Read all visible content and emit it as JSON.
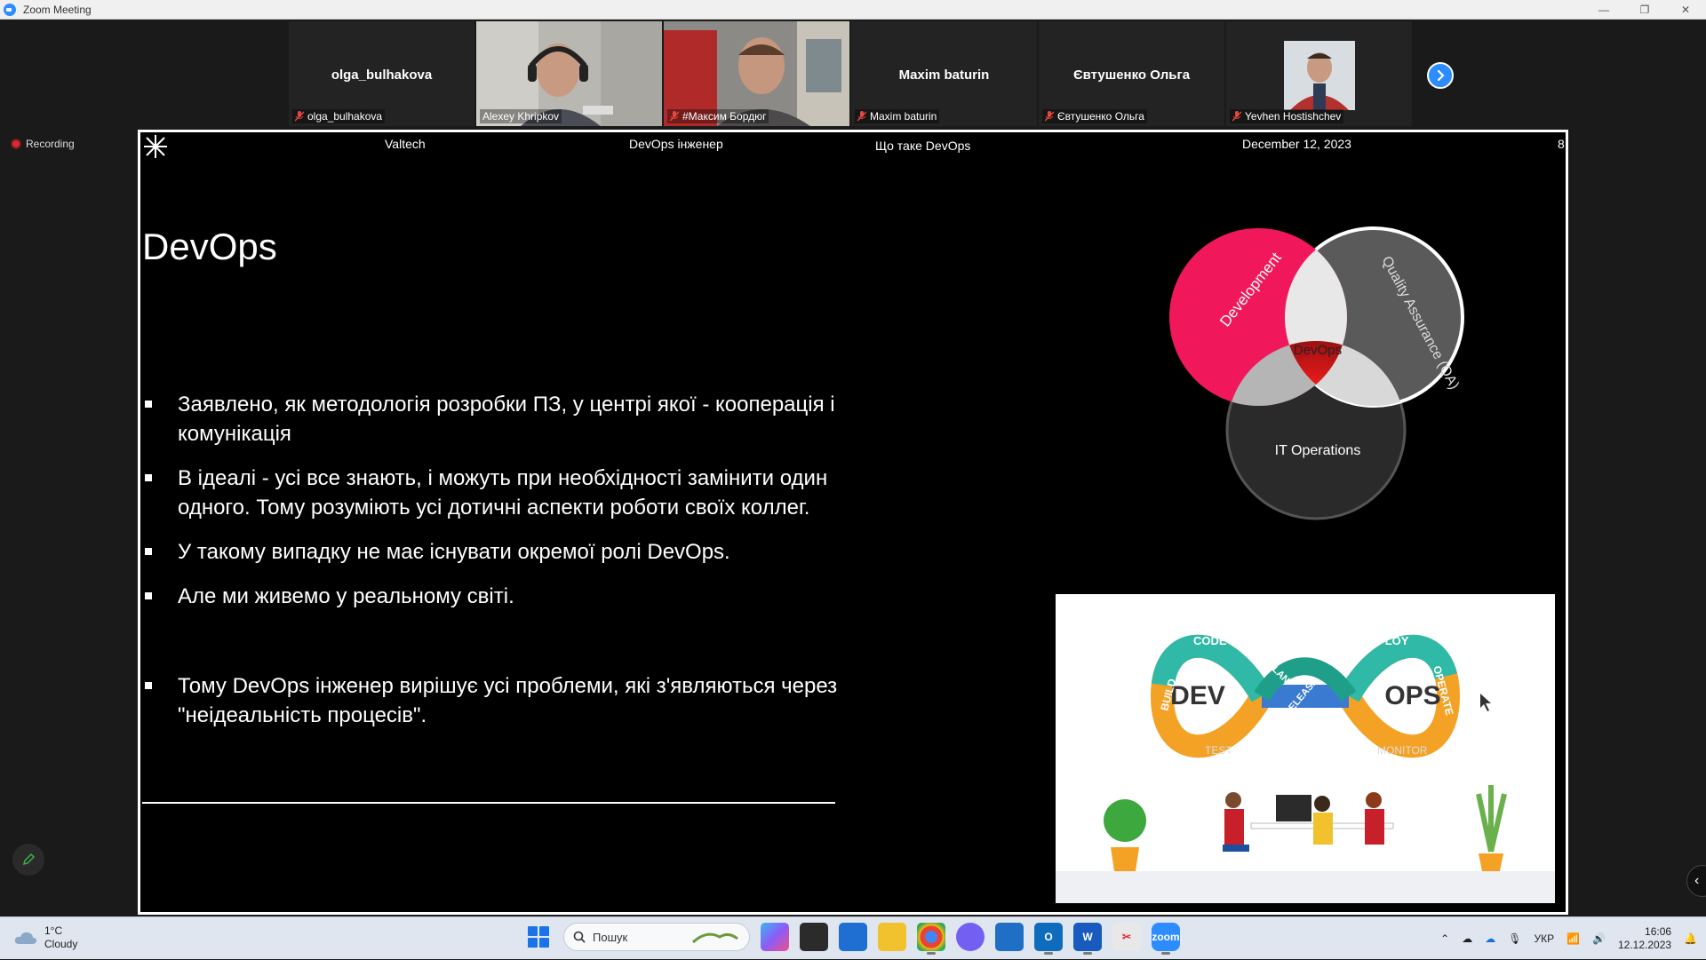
{
  "window": {
    "title": "Zoom Meeting",
    "controls": [
      "—",
      "❐",
      "✕"
    ]
  },
  "participants": [
    {
      "name": "olga_bulhakova",
      "caption": "olga_bulhakova",
      "video": false
    },
    {
      "name": "Alexey Khripkov",
      "caption": "Alexey Khripkov",
      "video": true,
      "active": true
    },
    {
      "name": "#Максим Бордюг",
      "caption": "#Максим Бордюг",
      "video": true
    },
    {
      "name": "Maxim baturin",
      "caption": "Maxim baturin",
      "video": false
    },
    {
      "name": "Євтушенко Ольга",
      "caption": "Євтушенко Ольга",
      "video": false
    },
    {
      "name": "Yevhen Hostishchev",
      "caption": "Yevhen Hostishchev",
      "video": true
    }
  ],
  "recording": {
    "label": "Recording"
  },
  "slide": {
    "header": {
      "company": "Valtech",
      "course": "DevOps інженер",
      "topic": "Що таке DevOps",
      "date": "December 12, 2023",
      "page": "8"
    },
    "title": "DevOps",
    "bullets": [
      "Заявлено, як методологія розробки ПЗ, у центрі якої - кооперація і комунікація",
      "В ідеалі - усі все знають, і можуть при необхідності замінити один одного. Тому розуміють усі дотичні аспекти роботи своїх коллег.",
      "У такому випадку не має існувати окремої ролі DevOps.",
      "Але ми живемо у реальному світі.",
      "Тому DevOps інженер вирішує усі проблеми, які з'являються через \"неідеальність процесів\"."
    ],
    "venn": {
      "development": "Development",
      "qa": "Quality Assurance (QA)",
      "ops": "IT Operations",
      "center": "DevOps"
    },
    "infinity": {
      "left": "DEV",
      "right": "OPS",
      "stages": [
        "CODE",
        "PLAN",
        "BUILD",
        "TEST",
        "RELEASE",
        "DEPLOY",
        "OPERATE",
        "MONITOR"
      ]
    }
  },
  "taskbar": {
    "weather": {
      "temp": "1°C",
      "condition": "Cloudy"
    },
    "search_placeholder": "Пошук",
    "language": "УКР",
    "time": "16:06",
    "date": "12.12.2023"
  }
}
